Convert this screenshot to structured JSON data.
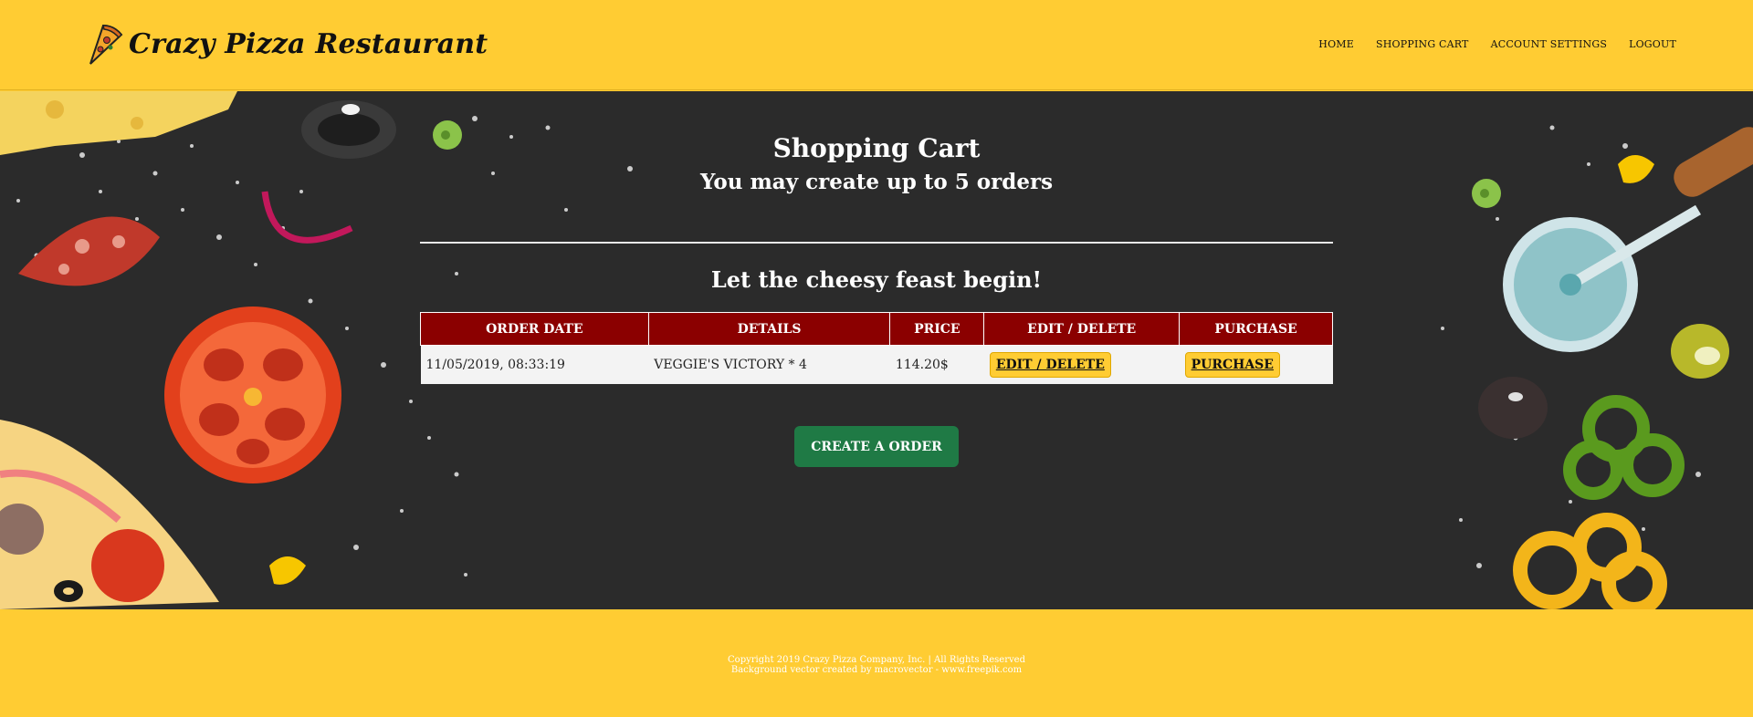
{
  "brand": {
    "name": "Crazy Pizza Restaurant"
  },
  "nav": {
    "items": [
      "HOME",
      "SHOPPING CART",
      "ACCOUNT SETTINGS",
      "LOGOUT"
    ]
  },
  "main": {
    "title": "Shopping Cart",
    "subtitle": "You may create up to 5 orders",
    "feast": "Let the cheesy feast begin!",
    "table": {
      "headers": [
        "ORDER DATE",
        "DETAILS",
        "PRICE",
        "EDIT / DELETE",
        "PURCHASE"
      ],
      "rows": [
        {
          "date": "11/05/2019, 08:33:19",
          "details": "VEGGIE'S VICTORY * 4",
          "price": "114.20$",
          "edit": "EDIT / DELETE",
          "purchase": "PURCHASE"
        }
      ]
    },
    "create_button": "CREATE A ORDER"
  },
  "footer": {
    "line1": "Copyright 2019 Crazy Pizza Company, Inc. | All Rights Reserved",
    "line2": "Background vector created by macrovector - www.freepik.com"
  },
  "colors": {
    "yellow": "#ffcc33",
    "dark": "#2b2b2b",
    "header_red": "#8b0000",
    "green": "#1f7a45"
  }
}
